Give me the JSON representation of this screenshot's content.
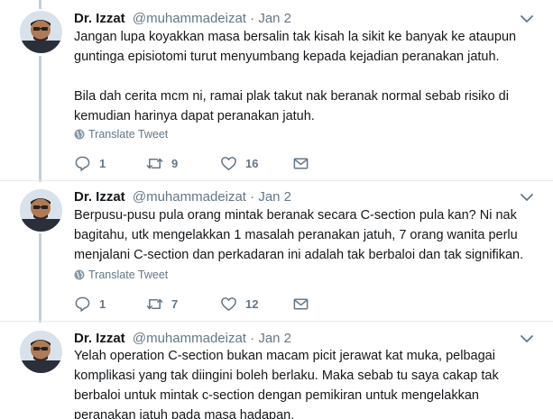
{
  "tweets": [
    {
      "name": "Dr. Izzat",
      "handle": "@muhammadeizat",
      "dot": "·",
      "date": "Jan 2",
      "lines": [
        "Jangan lupa koyakkan masa bersalin tak kisah la sikit ke banyak ke ataupun",
        "guntinga episiotomi turut menyumbang kepada kejadian peranakan jatuh.",
        "",
        "Bila dah cerita mcm ni, ramai plak takut nak beranak normal sebab risiko di",
        "kemudian harinya dapat peranakan jatuh."
      ],
      "translate": "Translate Tweet",
      "replies": "1",
      "retweets": "9",
      "likes": "16"
    },
    {
      "name": "Dr. Izzat",
      "handle": "@muhammadeizat",
      "dot": "·",
      "date": "Jan 2",
      "lines": [
        "Berpusu-pusu pula orang mintak beranak secara C-section pula kan? Ni nak",
        "bagitahu, utk mengelakkan 1 masalah peranakan jatuh, 7 orang wanita perlu",
        "menjalani C-section dan perkadaran ini adalah tak berbaloi dan tak signifikan."
      ],
      "translate": "Translate Tweet",
      "replies": "1",
      "retweets": "7",
      "likes": "12"
    },
    {
      "name": "Dr. Izzat",
      "handle": "@muhammadeizat",
      "dot": "·",
      "date": "Jan 2",
      "lines": [
        "Yelah operation C-section bukan macam picit jerawat kat muka, pelbagai",
        "komplikasi yang tak diingini boleh berlaku. Maka sebab tu saya cakap tak",
        "berbaloi untuk mintak c-section dengan pemikiran untuk mengelakkan",
        "peranakan jatuh pada masa hadapan."
      ]
    }
  ],
  "icons": {
    "reply": "reply-icon",
    "retweet": "retweet-icon",
    "like": "heart-icon",
    "dm": "envelope-icon",
    "caret": "chevron-down-icon",
    "translate": "globe-icon"
  },
  "colors": {
    "text": "#14171a",
    "muted": "#657786",
    "thread_line": "#c4cfd6",
    "divider": "#e6ecf0"
  }
}
